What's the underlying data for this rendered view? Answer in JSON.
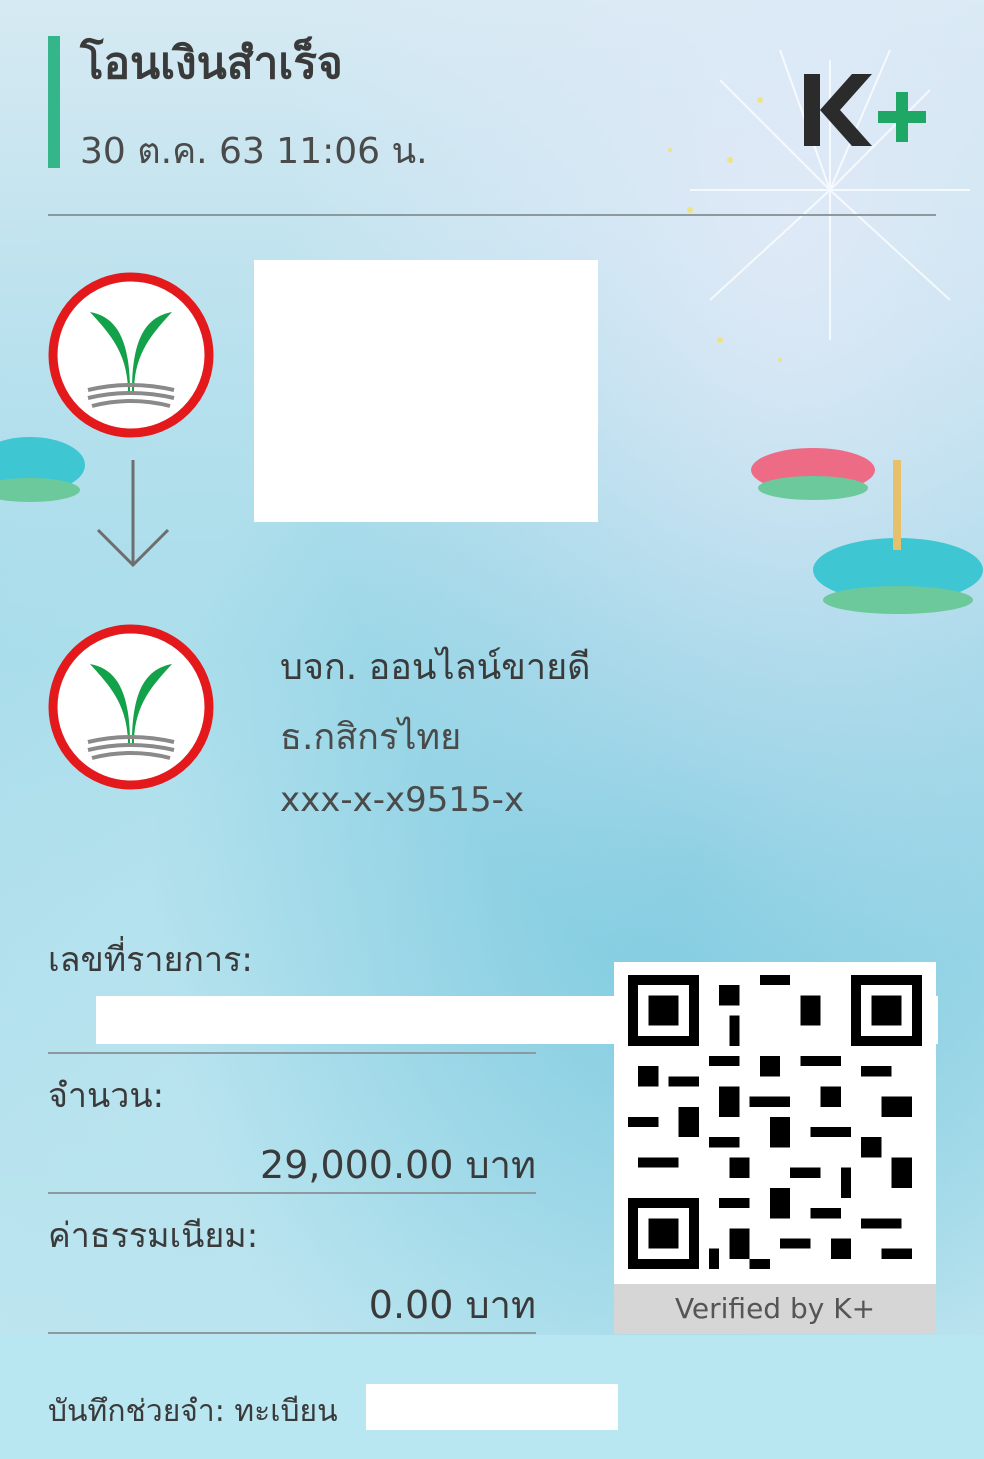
{
  "header": {
    "title": "โอนเงินสำเร็จ",
    "datetime": "30 ต.ค. 63  11:06 น.",
    "brand": "K+"
  },
  "recipient": {
    "name": "บจก. ออนไลน์ขายดี",
    "bank": "ธ.กสิกรไทย",
    "account": "xxx-x-x9515-x"
  },
  "transaction": {
    "ref_label": "เลขที่รายการ:",
    "amount_label": "จำนวน:",
    "amount_value": "29,000.00 บาท",
    "fee_label": "ค่าธรรมเนียม:",
    "fee_value": "0.00 บาท"
  },
  "qr": {
    "verified_label": "Verified by K+"
  },
  "memo": {
    "text": "บันทึกช่วยจำ: ทะเบียน"
  },
  "colors": {
    "accent": "#35b58a",
    "kplus_dark": "#2b2b2b",
    "kplus_green": "#1fa865",
    "kbank_red": "#e3191b",
    "kbank_green": "#13a14a"
  }
}
